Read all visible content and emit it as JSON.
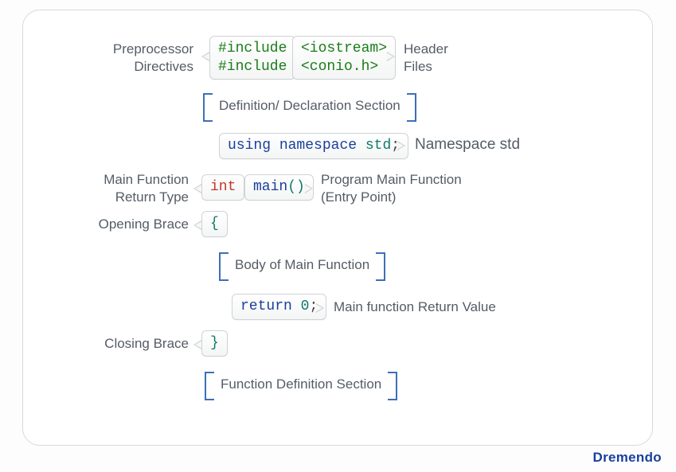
{
  "labels": {
    "preprocessor": "Preprocessor\nDirectives",
    "headerFiles": "Header\nFiles",
    "namespaceStd": "Namespace std",
    "mainReturnType": "Main Function\nReturn Type",
    "programMain": "Program Main Function\n(Entry Point)",
    "openingBrace": "Opening Brace",
    "closingBrace": "Closing Brace",
    "mainReturnValue": "Main function Return Value"
  },
  "sections": {
    "definition": "Definition/ Declaration Section",
    "body": "Body of Main Function",
    "functionDef": "Function Definition Section"
  },
  "code": {
    "includes": {
      "directive1": "#include",
      "directive2": "#include",
      "header1": "<iostream>",
      "header2": "<conio.h>"
    },
    "namespace": {
      "using": "using",
      "namespace": "namespace",
      "std": "std",
      "semi": ";"
    },
    "main": {
      "retType": "int",
      "name": "main",
      "parens": "()"
    },
    "openBrace": "{",
    "returnStmt": {
      "kw": "return",
      "val": "0",
      "semi": ";"
    },
    "closeBrace": "}"
  },
  "brand": "Dremendo"
}
